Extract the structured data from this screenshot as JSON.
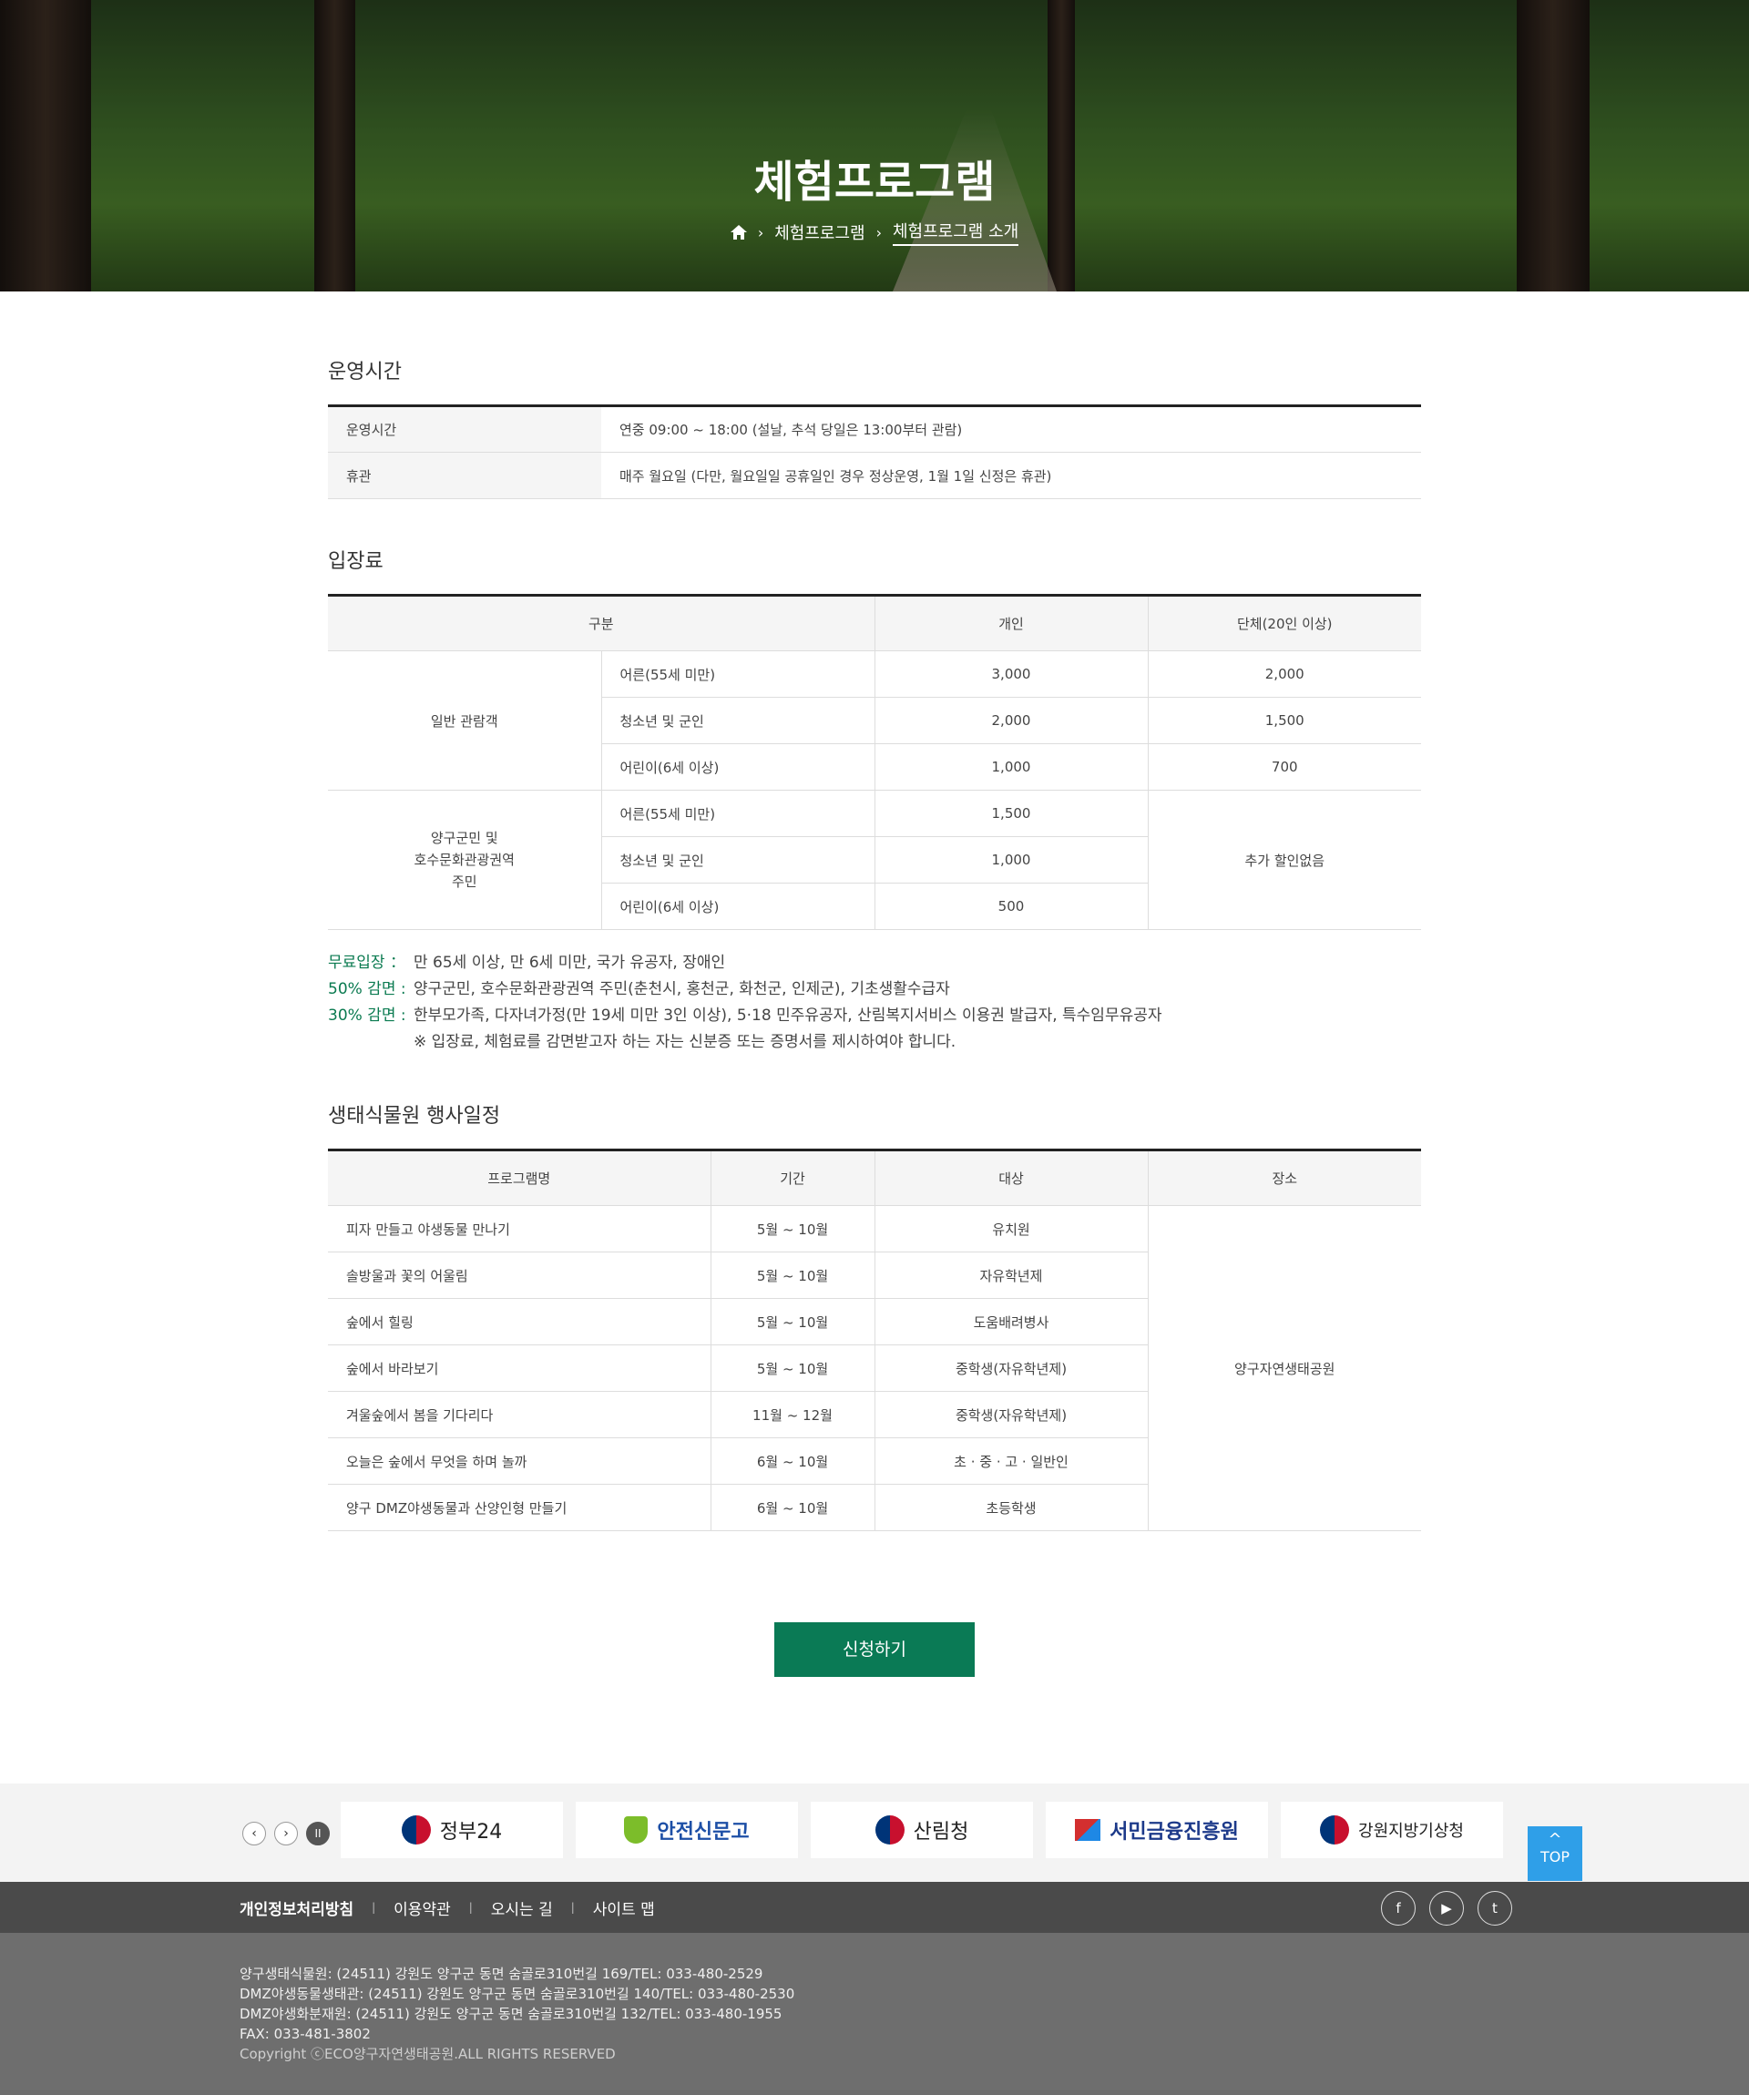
{
  "hero": {
    "title": "체험프로그램",
    "breadcrumb": [
      "체험프로그램",
      "체험프로그램 소개"
    ]
  },
  "hours": {
    "title": "운영시간",
    "rows": [
      {
        "label": "운영시간",
        "value": "연중 09:00 ~ 18:00 (설날, 추석 당일은 13:00부터 관람)"
      },
      {
        "label": "휴관",
        "value": "매주 월요일 (다만, 월요일일 공휴일인 경우 정상운영, 1월 1일 신정은 휴관)"
      }
    ]
  },
  "fees": {
    "title": "입장료",
    "headers": [
      "구분",
      "개인",
      "단체(20인 이상)"
    ],
    "general": {
      "group": "일반 관람객",
      "rows": [
        {
          "type": "어른(55세 미만)",
          "individual": "3,000",
          "group": "2,000"
        },
        {
          "type": "청소년 및 군인",
          "individual": "2,000",
          "group": "1,500"
        },
        {
          "type": "어린이(6세 이상)",
          "individual": "1,000",
          "group": "700"
        }
      ]
    },
    "local": {
      "group_lines": [
        "양구군민 및",
        "호수문화관광권역",
        "주민"
      ],
      "group_value": "추가 할인없음",
      "rows": [
        {
          "type": "어른(55세 미만)",
          "individual": "1,500"
        },
        {
          "type": "청소년 및 군인",
          "individual": "1,000"
        },
        {
          "type": "어린이(6세 이상)",
          "individual": "500"
        }
      ]
    },
    "notes": [
      {
        "label": "무료입장 ：",
        "text": "만 65세 이상, 만 6세 미만, 국가 유공자, 장애인"
      },
      {
        "label": "50% 감면 :",
        "text": "양구군민, 호수문화관광권역 주민(춘천시, 홍천군, 화천군, 인제군), 기초생활수급자"
      },
      {
        "label": "30% 감면 :",
        "text": "한부모가족, 다자녀가정(만 19세 미만 3인 이상), 5·18 민주유공자, 산림복지서비스 이용권 발급자, 특수임무유공자"
      }
    ],
    "remark": "※ 입장료, 체험료를 감면받고자 하는 자는 신분증 또는 증명서를 제시하여야 합니다."
  },
  "events": {
    "title": "생태식물원 행사일정",
    "headers": [
      "프로그램명",
      "기간",
      "대상",
      "장소"
    ],
    "place": "양구자연생태공원",
    "rows": [
      {
        "name": "피자 만들고 야생동물 만나기",
        "period": "5월 ~ 10월",
        "target": "유치원"
      },
      {
        "name": "솔방울과 꽃의 어울림",
        "period": "5월 ~ 10월",
        "target": "자유학년제"
      },
      {
        "name": "숲에서 힐링",
        "period": "5월 ~ 10월",
        "target": "도움배려병사"
      },
      {
        "name": "숲에서 바라보기",
        "period": "5월 ~ 10월",
        "target": "중학생(자유학년제)"
      },
      {
        "name": "겨울숲에서 봄을 기다리다",
        "period": "11월 ~ 12월",
        "target": "중학생(자유학년제)"
      },
      {
        "name": "오늘은 숲에서 무엇을 하며 놀까",
        "period": "6월 ~ 10월",
        "target": "초 · 중 · 고 · 일반인"
      },
      {
        "name": "양구 DMZ야생동물과 산양인형 만들기",
        "period": "6월 ~ 10월",
        "target": "초등학생"
      }
    ]
  },
  "apply_label": "신청하기",
  "banners": {
    "controls": [
      "‹",
      "›",
      "II"
    ],
    "items": [
      "정부24",
      "안전신문고",
      "산림청",
      "서민금융진흥원",
      "강원지방기상청"
    ]
  },
  "top_label": "TOP",
  "footer": {
    "links": [
      "개인정보처리방침",
      "이용약관",
      "오시는 길",
      "사이트 맵"
    ],
    "sns": [
      "f",
      "▶",
      "t"
    ],
    "address": [
      "양구생태식물원: (24511) 강원도 양구군 동면 숨골로310번길 169/TEL: 033-480-2529",
      "DMZ야생동물생태관: (24511) 강원도 양구군 동면 숨골로310번길 140/TEL: 033-480-2530",
      "DMZ야생화분재원: (24511) 강원도 양구군 동면 숨골로310번길 132/TEL: 033-480-1955",
      "FAX: 033-481-3802"
    ],
    "copyright": "Copyright ⓒECO양구자연생태공원.ALL RIGHTS RESERVED"
  },
  "colors": {
    "accent": "#0a7a55",
    "note_label": "#0a7a50",
    "top_button": "#2f9fe8"
  }
}
